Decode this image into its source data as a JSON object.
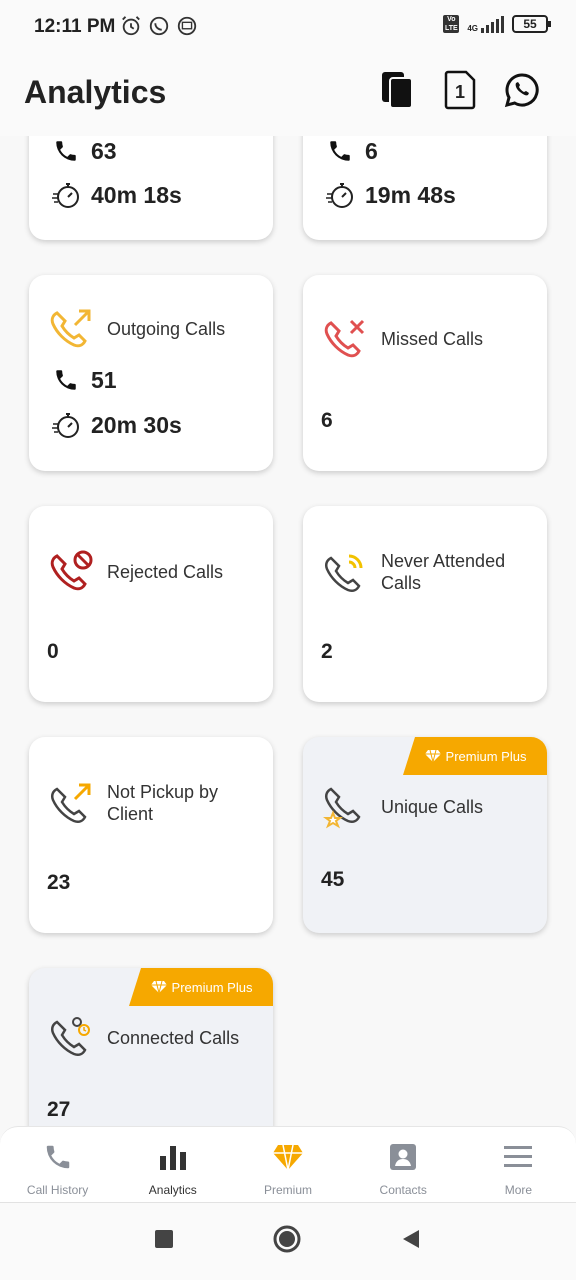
{
  "status_bar": {
    "time": "12:11 PM",
    "battery": "55",
    "network": "4G",
    "lte_badge": "Vo LTE"
  },
  "header": {
    "title": "Analytics",
    "sim_label": "1"
  },
  "cards": {
    "top_left": {
      "calls": "63",
      "duration": "40m 18s"
    },
    "top_right": {
      "calls": "6",
      "duration": "19m 48s"
    },
    "outgoing": {
      "title": "Outgoing Calls",
      "calls": "51",
      "duration": "20m 30s"
    },
    "missed": {
      "title": "Missed Calls",
      "value": "6"
    },
    "rejected": {
      "title": "Rejected Calls",
      "value": "0"
    },
    "never_attended": {
      "title": "Never Attended Calls",
      "value": "2"
    },
    "not_pickup": {
      "title": "Not Pickup by Client",
      "value": "23"
    },
    "unique": {
      "title": "Unique Calls",
      "value": "45",
      "badge": "Premium Plus"
    },
    "connected": {
      "title": "Connected Calls",
      "value": "27",
      "badge": "Premium Plus"
    }
  },
  "bottom_nav": {
    "items": [
      {
        "label": "Call History",
        "icon": "phone-icon"
      },
      {
        "label": "Analytics",
        "icon": "bar-chart-icon"
      },
      {
        "label": "Premium",
        "icon": "diamond-icon"
      },
      {
        "label": "Contacts",
        "icon": "contact-card-icon"
      },
      {
        "label": "More",
        "icon": "menu-icon"
      }
    ],
    "active_index": 1
  },
  "colors": {
    "accent_orange": "#f6a800",
    "missed_red": "#e05050",
    "rejected_red": "#b02020"
  }
}
